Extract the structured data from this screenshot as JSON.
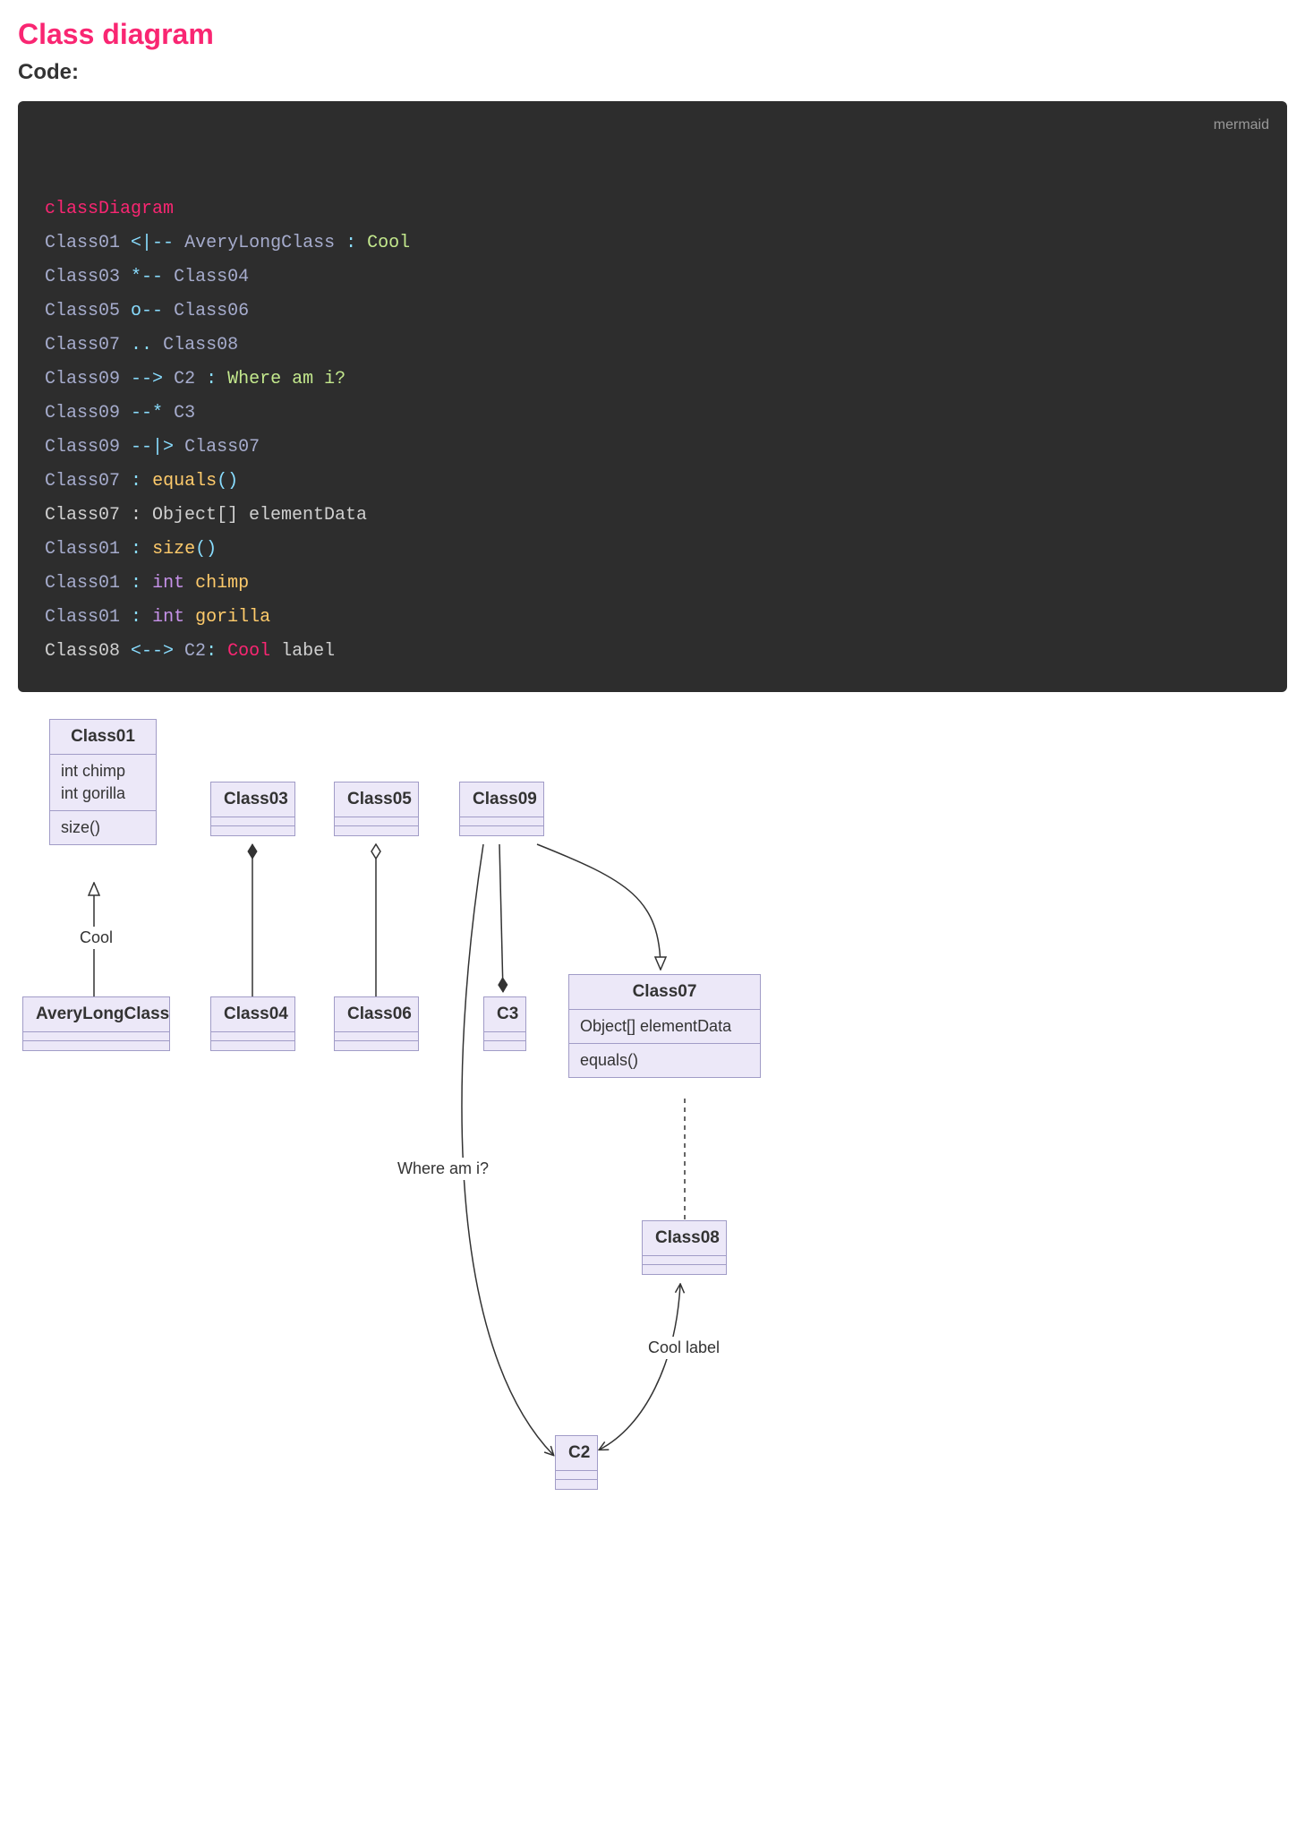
{
  "heading": "Class diagram",
  "subheading": "Code:",
  "code_lang": "mermaid",
  "code": {
    "keyword": "classDiagram",
    "lines": [
      {
        "raw": "Class01 <|-- AveryLongClass : Cool"
      },
      {
        "raw": "Class03 *-- Class04"
      },
      {
        "raw": "Class05 o-- Class06"
      },
      {
        "raw": "Class07 .. Class08"
      },
      {
        "raw": "Class09 --> C2 : Where am i?"
      },
      {
        "raw": "Class09 --* C3"
      },
      {
        "raw": "Class09 --|> Class07"
      },
      {
        "raw": "Class07 : equals()"
      },
      {
        "raw": "Class07 : Object[] elementData"
      },
      {
        "raw": "Class01 : size()"
      },
      {
        "raw": "Class01 : int chimp"
      },
      {
        "raw": "Class01 : int gorilla"
      },
      {
        "raw": "Class08 <--> C2: Cool label"
      }
    ]
  },
  "diagram": {
    "classes": {
      "Class01": {
        "name": "Class01",
        "attributes": [
          "int chimp",
          "int gorilla"
        ],
        "methods": [
          "size()"
        ]
      },
      "AveryLongClass": {
        "name": "AveryLongClass",
        "attributes": [],
        "methods": []
      },
      "Class03": {
        "name": "Class03",
        "attributes": [],
        "methods": []
      },
      "Class04": {
        "name": "Class04",
        "attributes": [],
        "methods": []
      },
      "Class05": {
        "name": "Class05",
        "attributes": [],
        "methods": []
      },
      "Class06": {
        "name": "Class06",
        "attributes": [],
        "methods": []
      },
      "Class07": {
        "name": "Class07",
        "attributes": [
          "Object[] elementData"
        ],
        "methods": [
          "equals()"
        ]
      },
      "Class08": {
        "name": "Class08",
        "attributes": [],
        "methods": []
      },
      "Class09": {
        "name": "Class09",
        "attributes": [],
        "methods": []
      },
      "C2": {
        "name": "C2",
        "attributes": [],
        "methods": []
      },
      "C3": {
        "name": "C3",
        "attributes": [],
        "methods": []
      }
    },
    "edges": [
      {
        "from": "AveryLongClass",
        "to": "Class01",
        "type": "inheritance",
        "label": "Cool"
      },
      {
        "from": "Class03",
        "to": "Class04",
        "type": "composition",
        "label": ""
      },
      {
        "from": "Class05",
        "to": "Class06",
        "type": "aggregation",
        "label": ""
      },
      {
        "from": "Class07",
        "to": "Class08",
        "type": "dependency",
        "label": ""
      },
      {
        "from": "Class09",
        "to": "C2",
        "type": "association-arrow",
        "label": "Where am i?"
      },
      {
        "from": "Class09",
        "to": "C3",
        "type": "composition-rev",
        "label": ""
      },
      {
        "from": "Class09",
        "to": "Class07",
        "type": "inheritance",
        "label": ""
      },
      {
        "from": "Class08",
        "to": "C2",
        "type": "bidirectional",
        "label": "Cool label"
      }
    ]
  },
  "chart_data": {
    "type": "diagram",
    "diagram_kind": "uml-class-diagram",
    "nodes": [
      {
        "id": "Class01",
        "attributes": [
          "int chimp",
          "int gorilla"
        ],
        "methods": [
          "size()"
        ]
      },
      {
        "id": "AveryLongClass",
        "attributes": [],
        "methods": []
      },
      {
        "id": "Class03",
        "attributes": [],
        "methods": []
      },
      {
        "id": "Class04",
        "attributes": [],
        "methods": []
      },
      {
        "id": "Class05",
        "attributes": [],
        "methods": []
      },
      {
        "id": "Class06",
        "attributes": [],
        "methods": []
      },
      {
        "id": "Class07",
        "attributes": [
          "Object[] elementData"
        ],
        "methods": [
          "equals()"
        ]
      },
      {
        "id": "Class08",
        "attributes": [],
        "methods": []
      },
      {
        "id": "Class09",
        "attributes": [],
        "methods": []
      },
      {
        "id": "C2",
        "attributes": [],
        "methods": []
      },
      {
        "id": "C3",
        "attributes": [],
        "methods": []
      }
    ],
    "edges": [
      {
        "from": "Class01",
        "to": "AveryLongClass",
        "relation": "<|--",
        "label": "Cool"
      },
      {
        "from": "Class03",
        "to": "Class04",
        "relation": "*--",
        "label": ""
      },
      {
        "from": "Class05",
        "to": "Class06",
        "relation": "o--",
        "label": ""
      },
      {
        "from": "Class07",
        "to": "Class08",
        "relation": "..",
        "label": ""
      },
      {
        "from": "Class09",
        "to": "C2",
        "relation": "-->",
        "label": "Where am i?"
      },
      {
        "from": "Class09",
        "to": "C3",
        "relation": "--*",
        "label": ""
      },
      {
        "from": "Class09",
        "to": "Class07",
        "relation": "--|>",
        "label": ""
      },
      {
        "from": "Class08",
        "to": "C2",
        "relation": "<-->",
        "label": "Cool label"
      }
    ]
  }
}
